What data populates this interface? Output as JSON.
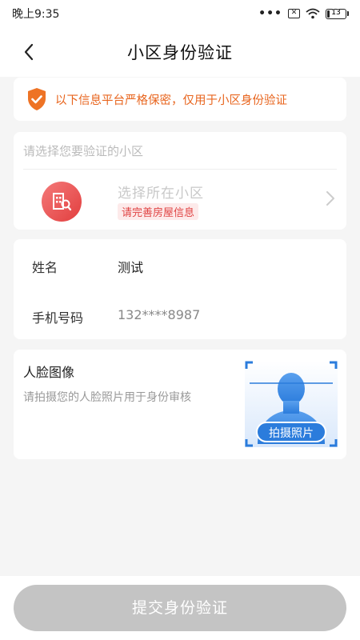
{
  "status_bar": {
    "time": "晚上9:35",
    "battery_level": "13",
    "battery_fraction": 0.13
  },
  "nav": {
    "title": "小区身份验证",
    "back_icon": "chevron-left-icon"
  },
  "notice": {
    "icon": "shield-check-icon",
    "text": "以下信息平台严格保密，仅用于小区身份验证",
    "color": "#e8651e"
  },
  "community": {
    "placeholder": "请选择您要验证的小区",
    "select_label": "选择所在小区",
    "warning": "请完善房屋信息",
    "icon": "building-search-icon"
  },
  "info": {
    "name_label": "姓名",
    "name_value": "测试",
    "phone_label": "手机号码",
    "phone_value": "132****8987"
  },
  "face": {
    "title": "人脸图像",
    "description": "请拍摄您的人脸照片用于身份审核",
    "photo_button": "拍摄照片",
    "accent": "#2b7cdc"
  },
  "submit": {
    "label": "提交身份验证"
  }
}
